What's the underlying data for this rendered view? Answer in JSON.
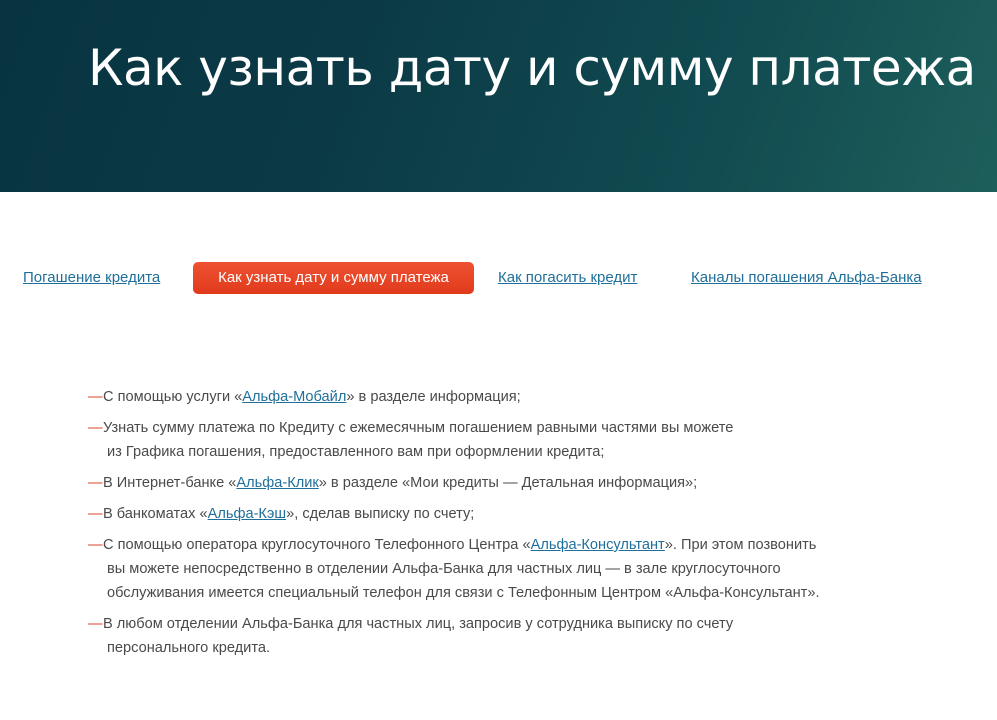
{
  "hero": {
    "title": "Как узнать дату и сумму платежа"
  },
  "tabs": {
    "items": [
      {
        "label": "Погашение кредита",
        "active": false
      },
      {
        "label": "Как узнать дату и сумму платежа",
        "active": true
      },
      {
        "label": "Как погасить кредит",
        "active": false
      },
      {
        "label": "Каналы погашения Альфа-Банка",
        "active": false
      }
    ]
  },
  "list": {
    "dash": "—",
    "items": [
      {
        "before": "С помощью услуги «",
        "link": "Альфа-Мобайл",
        "after": "» в разделе информация;"
      },
      {
        "line1": "Узнать сумму платежа по Кредиту с ежемесячным погашением равными частями вы можете",
        "line2": "из Графика погашения, предоставленного вам при оформлении кредита;"
      },
      {
        "before": "В Интернет-банке «",
        "link": "Альфа-Клик",
        "after": "» в разделе «Мои кредиты — Детальная информация»;"
      },
      {
        "before": "В банкоматах «",
        "link": "Альфа-Кэш",
        "after": "», сделав выписку по счету;"
      },
      {
        "before": "С помощью оператора круглосуточного Телефонного Центра «",
        "link": "Альфа-Консультант",
        "after": "». При этом позвонить",
        "line2": "вы можете непосредственно в отделении Альфа-Банка для частных лиц — в зале круглосуточного",
        "line3": "обслуживания имеется специальный телефон для связи с Телефонным Центром «Альфа-Консультант»."
      },
      {
        "line1": "В любом отделении Альфа-Банка для частных лиц, запросив у сотрудника выписку по счету",
        "line2": "персонального кредита."
      }
    ]
  },
  "colors": {
    "hero_bg": "#0b3a46",
    "accent": "#e8452a",
    "link": "#1f6f9a",
    "text": "#4a4a4a"
  }
}
